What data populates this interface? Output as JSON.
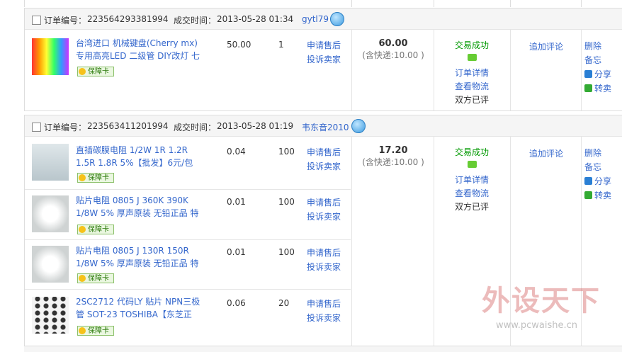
{
  "orders": [
    {
      "labels": {
        "order_no": "订单编号：",
        "deal_time": "成交时间："
      },
      "order_no": "223564293381994",
      "deal_time": "2013-05-28 01:34",
      "seller": "gytl79",
      "items": [
        {
          "title": "台湾进口 机械键盘(Cherry mx) 专用高亮LED 二级管 DIY改灯 七",
          "price": "50.00",
          "qty": "1",
          "badge": "保障卡",
          "svc1": "申请售后",
          "svc2": "投诉卖家"
        }
      ],
      "amount": "60.00",
      "shipping": "(含快递:10.00 )",
      "status": "交易成功",
      "status_links": [
        "订单详情",
        "查看物流",
        "双方已评"
      ],
      "review": "追加评论",
      "ops": [
        "删除",
        "备忘",
        "分享",
        "转卖"
      ]
    },
    {
      "labels": {
        "order_no": "订单编号：",
        "deal_time": "成交时间："
      },
      "order_no": "223563411201994",
      "deal_time": "2013-05-28 01:19",
      "seller": "韦东音2010",
      "items": [
        {
          "title": "直插碳膜电阻 1/2W 1R 1.2R 1.5R 1.8R 5%【批发】6元/包",
          "price": "0.04",
          "qty": "100",
          "badge": "保障卡",
          "svc1": "申请售后",
          "svc2": "投诉卖家"
        },
        {
          "title": "贴片电阻 0805 J 360K 390K 1/8W 5% 厚声原装 无铅正品 特",
          "price": "0.01",
          "qty": "100",
          "badge": "保障卡",
          "svc1": "申请售后",
          "svc2": "投诉卖家"
        },
        {
          "title": "贴片电阻 0805 J 130R 150R 1/8W 5% 厚声原装 无铅正品 特",
          "price": "0.01",
          "qty": "100",
          "badge": "保障卡",
          "svc1": "申请售后",
          "svc2": "投诉卖家"
        },
        {
          "title": "2SC2712 代码LY 贴片 NPN三极管 SOT-23 TOSHIBA【东芝正",
          "price": "0.06",
          "qty": "20",
          "badge": "保障卡",
          "svc1": "申请售后",
          "svc2": "投诉卖家"
        }
      ],
      "amount": "17.20",
      "shipping": "(含快递:10.00 )",
      "status": "交易成功",
      "status_links": [
        "订单详情",
        "查看物流",
        "双方已评"
      ],
      "review": "追加评论",
      "ops": [
        "删除",
        "备忘",
        "分享",
        "转卖"
      ]
    }
  ],
  "watermark": {
    "brand": "外设天下",
    "url": "www.pcwaishe.cn"
  },
  "colors": {
    "link": "#3366cc",
    "success": "#009900",
    "header_bg": "#f5f5f5"
  }
}
